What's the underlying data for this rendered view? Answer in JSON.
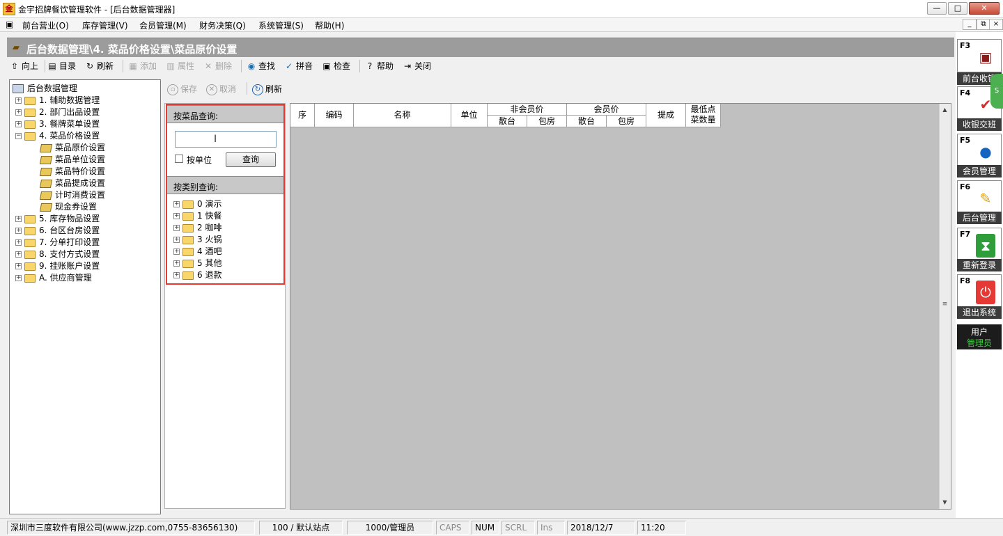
{
  "window": {
    "title": "金宇招牌餐饮管理软件 - [后台数据管理器]",
    "min_label": "—",
    "max_label": "□",
    "close_label": "✕"
  },
  "menu": {
    "items": [
      "前台营业(O)",
      "库存管理(V)",
      "会员管理(M)",
      "财务决策(Q)",
      "系统管理(S)",
      "帮助(H)"
    ]
  },
  "mdi": {
    "min": "_",
    "restore": "⧉",
    "close": "×"
  },
  "header": {
    "path": "后台数据管理\\4. 菜品价格设置\\菜品原价设置"
  },
  "toolbar": {
    "up": "向上",
    "catalog": "目录",
    "refresh": "刷新",
    "add": "添加",
    "props": "属性",
    "delete": "删除",
    "find": "查找",
    "pinyin": "拼音",
    "check": "检查",
    "help": "帮助",
    "close": "关闭"
  },
  "tree": {
    "root": "后台数据管理",
    "items": [
      {
        "label": "1. 辅助数据管理"
      },
      {
        "label": "2. 部门出品设置"
      },
      {
        "label": "3. 餐牌菜单设置"
      },
      {
        "label": "4. 菜品价格设置"
      },
      {
        "label": "5. 库存物品设置"
      },
      {
        "label": "6. 台区台房设置"
      },
      {
        "label": "7. 分单打印设置"
      },
      {
        "label": "8. 支付方式设置"
      },
      {
        "label": "9. 挂账账户设置"
      },
      {
        "label": "A. 供应商管理"
      }
    ],
    "children": [
      "菜品原价设置",
      "菜品单位设置",
      "菜品特价设置",
      "菜品提成设置",
      "计时消费设置",
      "现金券设置"
    ]
  },
  "subtoolbar": {
    "save": "保存",
    "cancel": "取消",
    "refresh": "刷新"
  },
  "query": {
    "by_dish_title": "按菜品查询:",
    "input_value": "",
    "by_unit_label": "按单位",
    "query_button": "查询",
    "by_category_title": "按类别查询:",
    "categories": [
      "0 演示",
      "1 快餐",
      "2 咖啡",
      "3 火锅",
      "4 酒吧",
      "5 其他",
      "6 退款"
    ]
  },
  "grid": {
    "col_seq": "序",
    "col_code": "编码",
    "col_name": "名称",
    "col_unit": "单位",
    "group_nonmember": "非会员价",
    "group_member": "会员价",
    "sub_hall": "散台",
    "sub_room": "包房",
    "col_commission": "提成",
    "col_min_line1": "最低点",
    "col_min_line2": "菜数量"
  },
  "shortcuts": [
    {
      "key": "F3",
      "label": "前台收银",
      "icon": "cashier-icon",
      "color": "#8b1a1a"
    },
    {
      "key": "F4",
      "label": "收银交班",
      "icon": "clipboard-icon",
      "color": "#d32f2f"
    },
    {
      "key": "F5",
      "label": "会员管理",
      "icon": "members-icon",
      "color": "#1565c0"
    },
    {
      "key": "F6",
      "label": "后台管理",
      "icon": "tools-icon",
      "color": "#e0a000"
    },
    {
      "key": "F7",
      "label": "重新登录",
      "icon": "hourglass-icon",
      "color": "#2e9d3a"
    },
    {
      "key": "F8",
      "label": "退出系统",
      "icon": "power-icon",
      "color": "#e53935"
    }
  ],
  "user": {
    "label": "用户",
    "name": "管理员"
  },
  "statusbar": {
    "company": "深圳市三度软件有限公司(www.jzzp.com,0755-83656130)",
    "station": "100 / 默认站点",
    "operator": "1000/管理员",
    "caps": "CAPS",
    "num": "NUM",
    "scrl": "SCRL",
    "ins": "Ins",
    "date": "2018/12/7",
    "time": "11:20"
  }
}
